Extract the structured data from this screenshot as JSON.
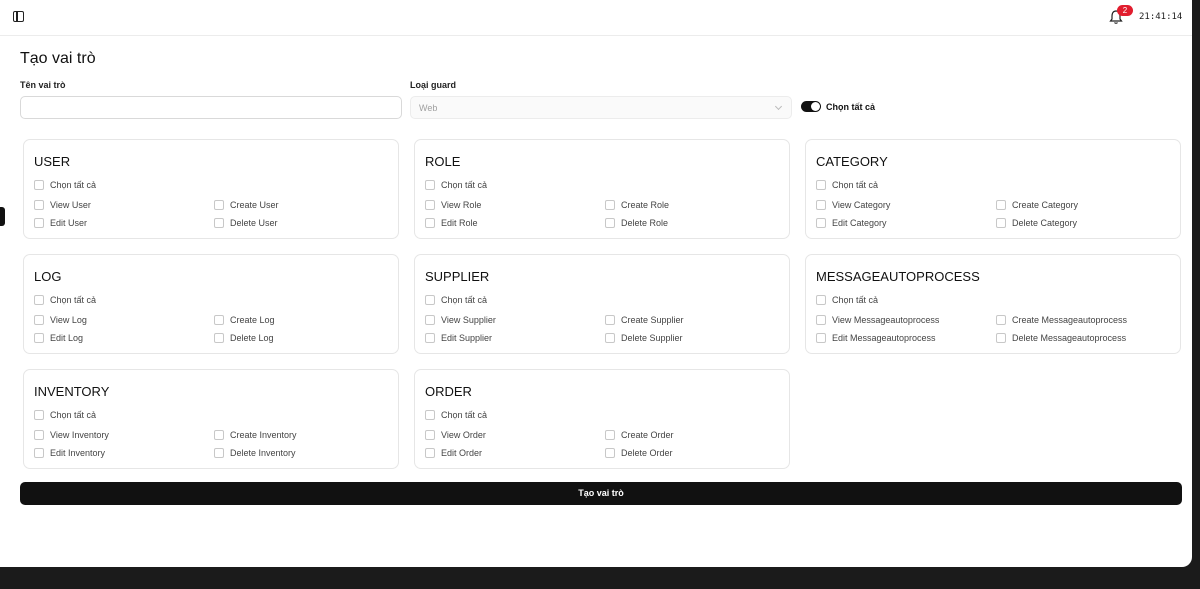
{
  "header": {
    "notification_count": "2",
    "time": "21:41:14"
  },
  "page": {
    "title": "Tạo vai trò",
    "role_name_label": "Tên vai trò",
    "role_name_value": "",
    "guard_label": "Loại guard",
    "guard_value": "Web",
    "select_all_toggle_label": "Chọn tất cả",
    "select_all_toggle_on": true,
    "submit_label": "Tạo vai trò"
  },
  "groups": [
    {
      "title": "USER",
      "select_all": "Chọn tất cả",
      "view": "View User",
      "create": "Create User",
      "edit": "Edit User",
      "delete": "Delete User"
    },
    {
      "title": "ROLE",
      "select_all": "Chọn tất cả",
      "view": "View Role",
      "create": "Create Role",
      "edit": "Edit Role",
      "delete": "Delete Role"
    },
    {
      "title": "CATEGORY",
      "select_all": "Chọn tất cả",
      "view": "View Category",
      "create": "Create Category",
      "edit": "Edit Category",
      "delete": "Delete Category"
    },
    {
      "title": "LOG",
      "select_all": "Chọn tất cả",
      "view": "View Log",
      "create": "Create Log",
      "edit": "Edit Log",
      "delete": "Delete Log"
    },
    {
      "title": "SUPPLIER",
      "select_all": "Chọn tất cả",
      "view": "View Supplier",
      "create": "Create Supplier",
      "edit": "Edit Supplier",
      "delete": "Delete Supplier"
    },
    {
      "title": "MESSAGEAUTOPROCESS",
      "select_all": "Chọn tất cả",
      "view": "View Messageautoprocess",
      "create": "Create Messageautoprocess",
      "edit": "Edit Messageautoprocess",
      "delete": "Delete Messageautoprocess"
    },
    {
      "title": "INVENTORY",
      "select_all": "Chọn tất cả",
      "view": "View Inventory",
      "create": "Create Inventory",
      "edit": "Edit Inventory",
      "delete": "Delete Inventory"
    },
    {
      "title": "ORDER",
      "select_all": "Chọn tất cả",
      "view": "View Order",
      "create": "Create Order",
      "edit": "Edit Order",
      "delete": "Delete Order"
    }
  ],
  "icons": {
    "sidebar_toggle": "sidebar-toggle-icon",
    "notification": "bell-icon",
    "dropdown": "chevron-down-icon"
  },
  "colors": {
    "primary": "#111111",
    "badge": "#e11d2e"
  }
}
